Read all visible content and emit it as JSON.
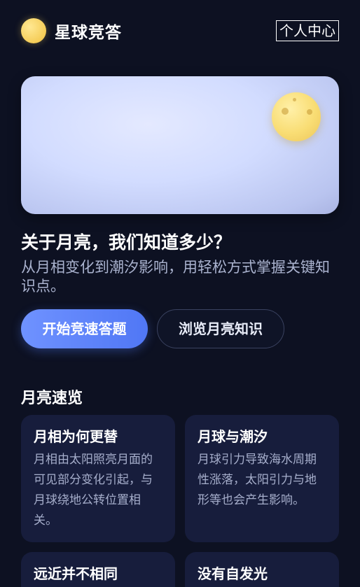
{
  "header": {
    "brand": "星球竞答",
    "profile_label": "个人中心"
  },
  "hero": {
    "title": "关于月亮，我们知道多少？",
    "subtitle": "从月相变化到潮汐影响，用轻松方式掌握关键知识点。"
  },
  "actions": {
    "start_quiz": "开始竞速答题",
    "browse": "浏览月亮知识"
  },
  "overview": {
    "title": "月亮速览",
    "cards": [
      {
        "title": "月相为何更替",
        "body": "月相由太阳照亮月面的可见部分变化引起，与月球绕地公转位置相关。"
      },
      {
        "title": "月球与潮汐",
        "body": "月球引力导致海水周期性涨落，太阳引力与地形等也会产生影响。"
      },
      {
        "title": "远近并不相同",
        "body": ""
      },
      {
        "title": "没有自发光",
        "body": ""
      }
    ]
  },
  "colors": {
    "background": "#0d1122",
    "accent": "#5a80f7",
    "card": "#171d3c",
    "moon": "#f7d768"
  },
  "icons": {
    "logo": "moon-icon",
    "hero_illustration": "moon-illustration"
  }
}
